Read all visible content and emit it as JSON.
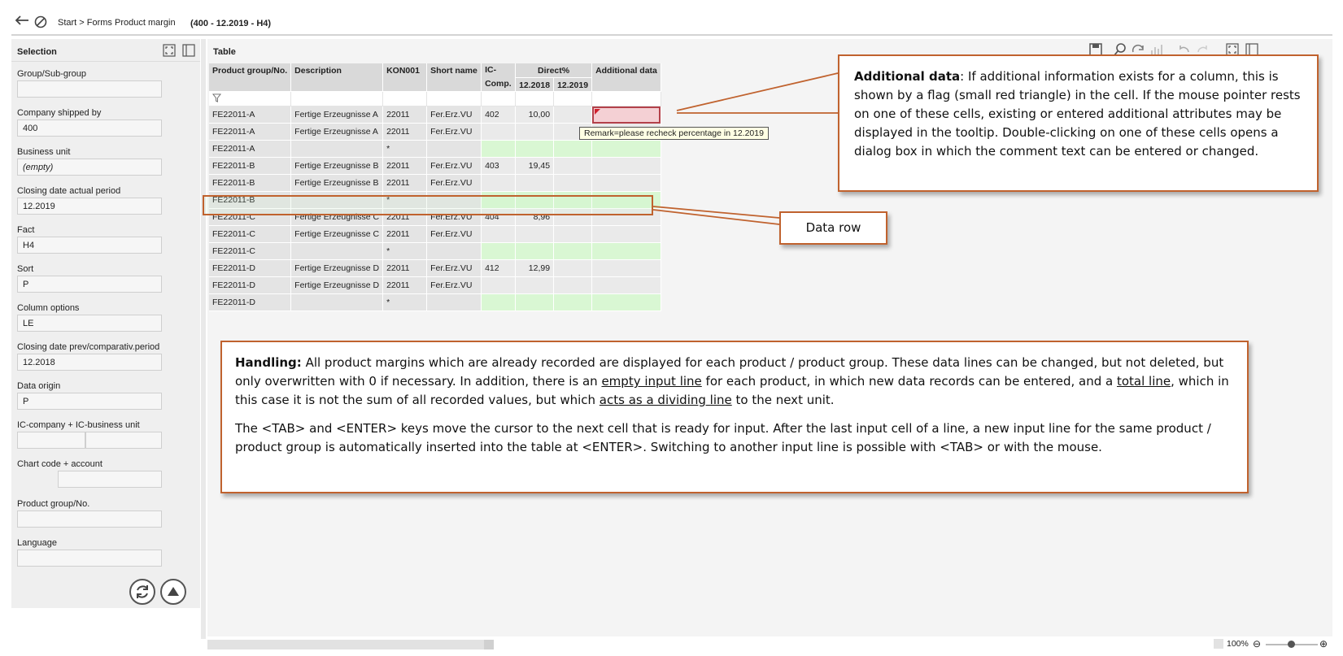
{
  "topbar": {
    "breadcrumb": "Start > Forms Product margin",
    "context": "(400 - 12.2019 - H4)"
  },
  "selection": {
    "title": "Selection",
    "fields": [
      {
        "label": "Group/Sub-group",
        "value": ""
      },
      {
        "label": "Company shipped by",
        "value": "400"
      },
      {
        "label": "Business unit",
        "value": "(empty)"
      },
      {
        "label": "Closing date actual period",
        "value": "12.2019"
      },
      {
        "label": "Fact",
        "value": "H4"
      },
      {
        "label": "Sort",
        "value": "P"
      },
      {
        "label": "Column options",
        "value": "LE"
      },
      {
        "label": "Closing date prev/comparativ.period",
        "value": "12.2018"
      },
      {
        "label": "Data origin",
        "value": "P"
      },
      {
        "label": "IC-company + IC-business unit",
        "value": ""
      },
      {
        "label": "Chart code + account",
        "value": ""
      },
      {
        "label": "Product group/No.",
        "value": ""
      },
      {
        "label": "Language",
        "value": ""
      }
    ]
  },
  "table": {
    "title": "Table",
    "headers": {
      "product_group": "Product group/No.",
      "description": "Description",
      "kon": "KON001",
      "short_name": "Short name",
      "ic_comp": "IC-Comp.",
      "direct": "Direct%",
      "y2018": "12.2018",
      "y2019": "12.2019",
      "additional": "Additional data"
    },
    "rows": [
      {
        "pg": "FE22011-A",
        "desc": "Fertige Erzeugnisse A",
        "kon": "22011",
        "short": "Fer.Erz.VU",
        "ic": "402",
        "d2018": "10,00",
        "d2019": "",
        "type": "data",
        "flag": true
      },
      {
        "pg": "FE22011-A",
        "desc": "Fertige Erzeugnisse A",
        "kon": "22011",
        "short": "Fer.Erz.VU",
        "ic": "",
        "d2018": "",
        "d2019": "",
        "type": "data"
      },
      {
        "pg": "FE22011-A",
        "desc": "",
        "kon": "*",
        "short": "",
        "ic": "",
        "d2018": "",
        "d2019": "",
        "type": "input"
      },
      {
        "pg": "FE22011-B",
        "desc": "Fertige Erzeugnisse B",
        "kon": "22011",
        "short": "Fer.Erz.VU",
        "ic": "403",
        "d2018": "19,45",
        "d2019": "",
        "type": "data"
      },
      {
        "pg": "FE22011-B",
        "desc": "Fertige Erzeugnisse B",
        "kon": "22011",
        "short": "Fer.Erz.VU",
        "ic": "",
        "d2018": "",
        "d2019": "",
        "type": "data"
      },
      {
        "pg": "FE22011-B",
        "desc": "",
        "kon": "*",
        "short": "",
        "ic": "",
        "d2018": "",
        "d2019": "",
        "type": "input"
      },
      {
        "pg": "FE22011-C",
        "desc": "Fertige Erzeugnisse C",
        "kon": "22011",
        "short": "Fer.Erz.VU",
        "ic": "404",
        "d2018": "8,96",
        "d2019": "",
        "type": "data"
      },
      {
        "pg": "FE22011-C",
        "desc": "Fertige Erzeugnisse C",
        "kon": "22011",
        "short": "Fer.Erz.VU",
        "ic": "",
        "d2018": "",
        "d2019": "",
        "type": "data"
      },
      {
        "pg": "FE22011-C",
        "desc": "",
        "kon": "*",
        "short": "",
        "ic": "",
        "d2018": "",
        "d2019": "",
        "type": "input"
      },
      {
        "pg": "FE22011-D",
        "desc": "Fertige Erzeugnisse D",
        "kon": "22011",
        "short": "Fer.Erz.VU",
        "ic": "412",
        "d2018": "12,99",
        "d2019": "",
        "type": "data"
      },
      {
        "pg": "FE22011-D",
        "desc": "Fertige Erzeugnisse D",
        "kon": "22011",
        "short": "Fer.Erz.VU",
        "ic": "",
        "d2018": "",
        "d2019": "",
        "type": "data"
      },
      {
        "pg": "FE22011-D",
        "desc": "",
        "kon": "*",
        "short": "",
        "ic": "",
        "d2018": "",
        "d2019": "",
        "type": "input"
      }
    ],
    "tooltip": "Remark=please recheck percentage in 12.2019"
  },
  "callouts": {
    "additional_title": "Additional data",
    "additional_text": ": If additional information exists for a column, this is shown by a flag (small red triangle) in the cell. If the mouse pointer rests on one of these cells, existing or entered additional attributes may be displayed in the tooltip. Double-clicking on one of these cells opens a dialog box in which the comment text can be entered or changed.",
    "data_row": "Data row",
    "handling_title": "Handling:",
    "handling_p1a": " All product margins which are already recorded are displayed for each product / product group. These data lines can be changed, but not deleted, but only overwritten with 0 if necessary. In addition, there is an ",
    "handling_u1": "empty input line",
    "handling_p1b": " for each product, in which new data records can be entered, and a ",
    "handling_u2": "total line",
    "handling_p1c": ", which in this case it is not the sum of all recorded values, but which ",
    "handling_u3": "acts as a dividing line",
    "handling_p1d": " to the next unit.",
    "handling_p2": "The <TAB> and <ENTER> keys move the cursor to the next cell that is ready for input. After the last input cell of a line, a new input line for the same product / product group is automatically inserted into the table at <ENTER>. Switching to another input line is possible with <TAB> or with the mouse."
  },
  "status": {
    "zoom": "100%"
  },
  "colors": {
    "accent": "#c0622e",
    "input_row": "#d9f7d3",
    "flag": "#b3414a"
  }
}
